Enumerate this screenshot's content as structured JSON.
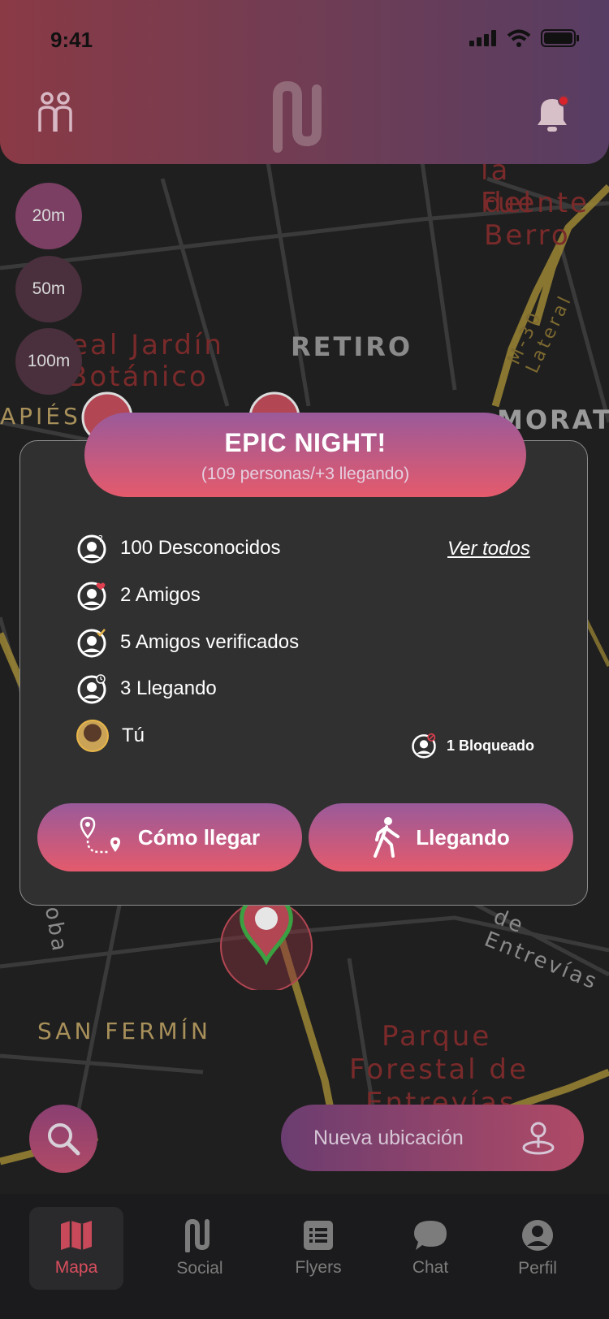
{
  "status_bar": {
    "time": "9:41"
  },
  "map": {
    "labels": [
      "RETIRO",
      "Real Jardín",
      "Botánico",
      "la Fuente",
      "del Berro",
      "M-30 Lateral",
      "MORAT",
      "APIÉS",
      "SAN FERMÍN",
      "Parque",
      "Forestal de",
      "Entrevías",
      "de Entrevías",
      "oba"
    ]
  },
  "distance_filters": [
    {
      "label": "20m",
      "selected": true
    },
    {
      "label": "50m",
      "selected": false
    },
    {
      "label": "100m",
      "selected": false
    }
  ],
  "event": {
    "title": "EPIC NIGHT!",
    "subtitle": "(109 personas/+3 llegando)",
    "see_all": "Ver todos",
    "rows": [
      {
        "label": "100 Desconocidos",
        "icon": "unknown-user-icon"
      },
      {
        "label": "2 Amigos",
        "icon": "friend-user-icon"
      },
      {
        "label": "5 Amigos verificados",
        "icon": "verified-friend-icon"
      },
      {
        "label": "3 Llegando",
        "icon": "arriving-user-icon"
      },
      {
        "label": "Tú",
        "icon": "avatar"
      }
    ],
    "blocked": "1 Bloqueado",
    "directions_button": "Cómo llegar",
    "arriving_button": "Llegando"
  },
  "new_location_button": "Nueva ubicación",
  "tabs": [
    {
      "label": "Mapa",
      "icon": "map-icon",
      "active": true
    },
    {
      "label": "Social",
      "icon": "social-logo-icon",
      "active": false
    },
    {
      "label": "Flyers",
      "icon": "flyers-list-icon",
      "active": false
    },
    {
      "label": "Chat",
      "icon": "chat-icon",
      "active": false
    },
    {
      "label": "Perfil",
      "icon": "profile-icon",
      "active": false
    }
  ],
  "colors": {
    "accent_top": "#9a5a9a",
    "accent_bottom": "#e45a6c",
    "active_tab": "#d84e5e",
    "map_road": "#a8903a"
  }
}
